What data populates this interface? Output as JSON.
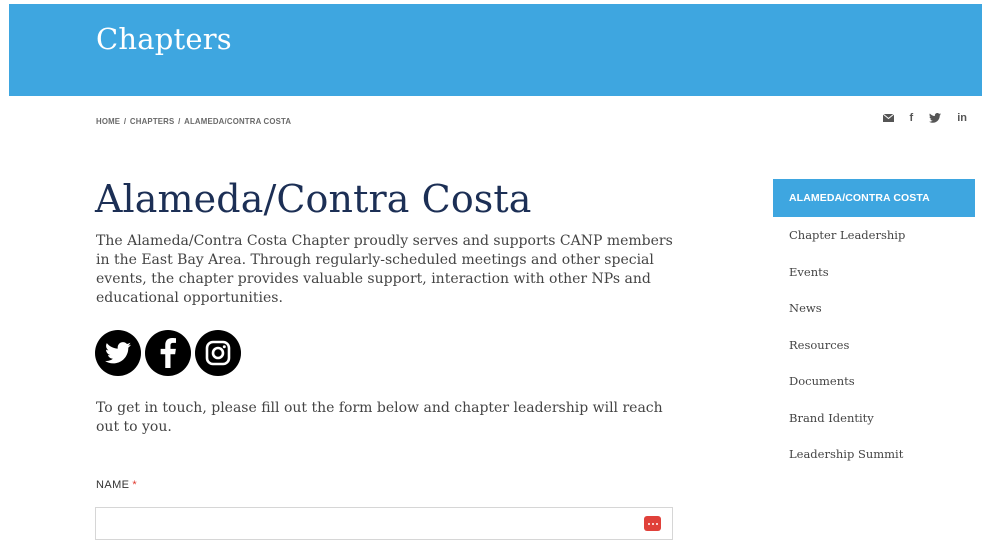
{
  "banner": {
    "title": "Chapters"
  },
  "breadcrumb": {
    "home": "HOME",
    "chapters": "CHAPTERS",
    "current": "ALAMEDA/CONTRA COSTA",
    "separator": "/"
  },
  "share": {
    "email_icon": "email-icon",
    "facebook": "f",
    "twitter_icon": "twitter-icon",
    "linkedin": "in"
  },
  "page": {
    "title": "Alameda/Contra Costa",
    "intro": "The Alameda/Contra Costa Chapter proudly serves and supports CANP members in the East Bay Area. Through regularly-scheduled meetings and other special events, the chapter provides valuable support, interaction with other NPs and educational opportunities.",
    "social_icons": [
      "twitter-icon",
      "facebook-icon",
      "instagram-icon"
    ],
    "contact_text": "To get in touch, please fill out the form below and chapter leadership will reach out to you."
  },
  "form": {
    "name_label": "NAME",
    "required_mark": "*",
    "name_value": ""
  },
  "sidebar": {
    "items": [
      {
        "label": "ALAMEDA/CONTRA COSTA",
        "active": true
      },
      {
        "label": "Chapter Leadership"
      },
      {
        "label": "Events"
      },
      {
        "label": "News"
      },
      {
        "label": "Resources"
      },
      {
        "label": "Documents"
      },
      {
        "label": "Brand Identity"
      },
      {
        "label": "Leadership Summit"
      }
    ]
  },
  "colors": {
    "accent": "#3ea6e0",
    "title": "#1c2f55",
    "required": "#e0382d"
  }
}
